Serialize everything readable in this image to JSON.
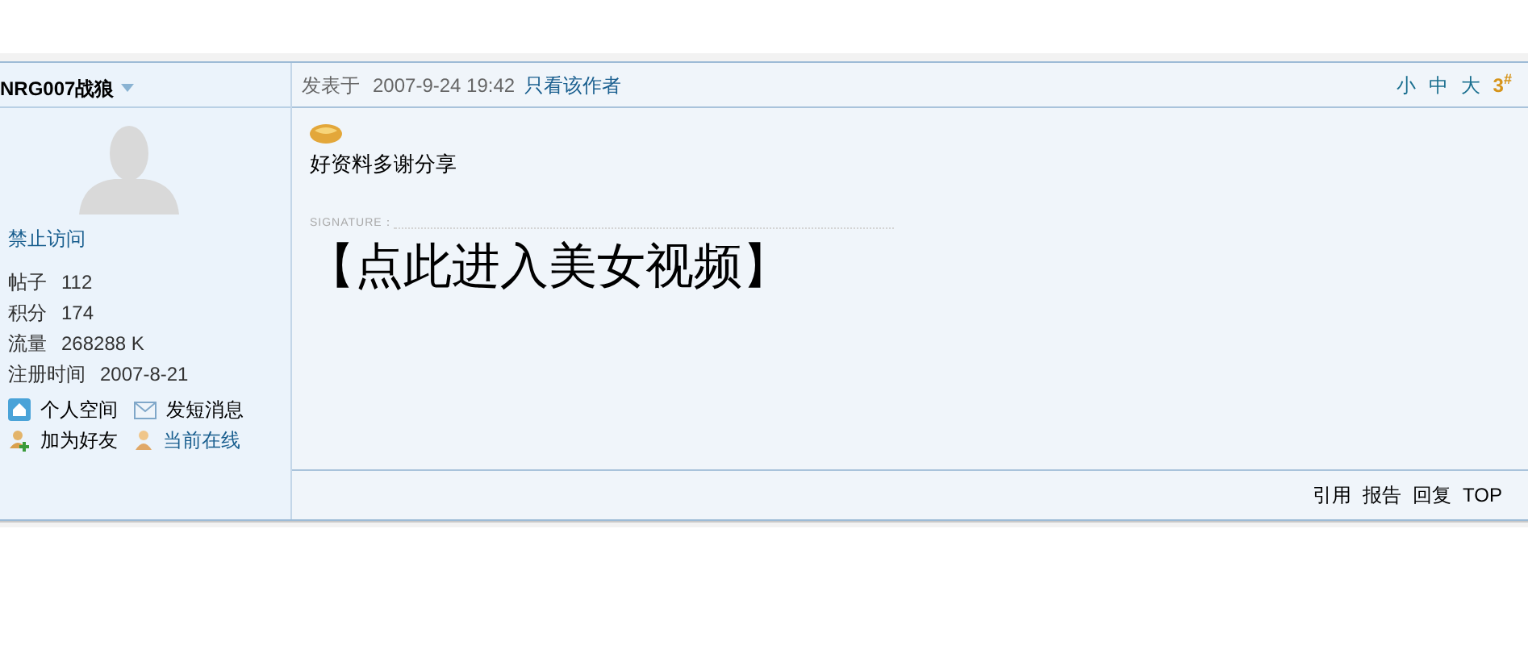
{
  "author": {
    "name": "NRG007战狼",
    "status_link": "禁止访问",
    "stats": [
      {
        "label": "帖子",
        "value": "112"
      },
      {
        "label": "积分",
        "value": "174"
      },
      {
        "label": "流量",
        "value": "268288 K"
      },
      {
        "label": "注册时间",
        "value": "2007-8-21"
      }
    ],
    "actions": [
      {
        "kind": "home",
        "label": "个人空间",
        "link": false
      },
      {
        "kind": "mail",
        "label": "发短消息",
        "link": false
      },
      {
        "kind": "add-friend",
        "label": "加为好友",
        "link": false
      },
      {
        "kind": "online",
        "label": "当前在线",
        "link": true
      }
    ]
  },
  "post": {
    "posted_label": "发表于",
    "time": "2007-9-24 19:42",
    "author_only": "只看该作者",
    "font_sizes": [
      "小",
      "中",
      "大"
    ],
    "floor": "3$^{#}$",
    "message": "好资料多谢分享",
    "signature_label": "SIGNATURE：",
    "signature": "【点此进入美女视频】",
    "footer_links": [
      "引用",
      "报告",
      "回复",
      "TOP"
    ]
  }
}
